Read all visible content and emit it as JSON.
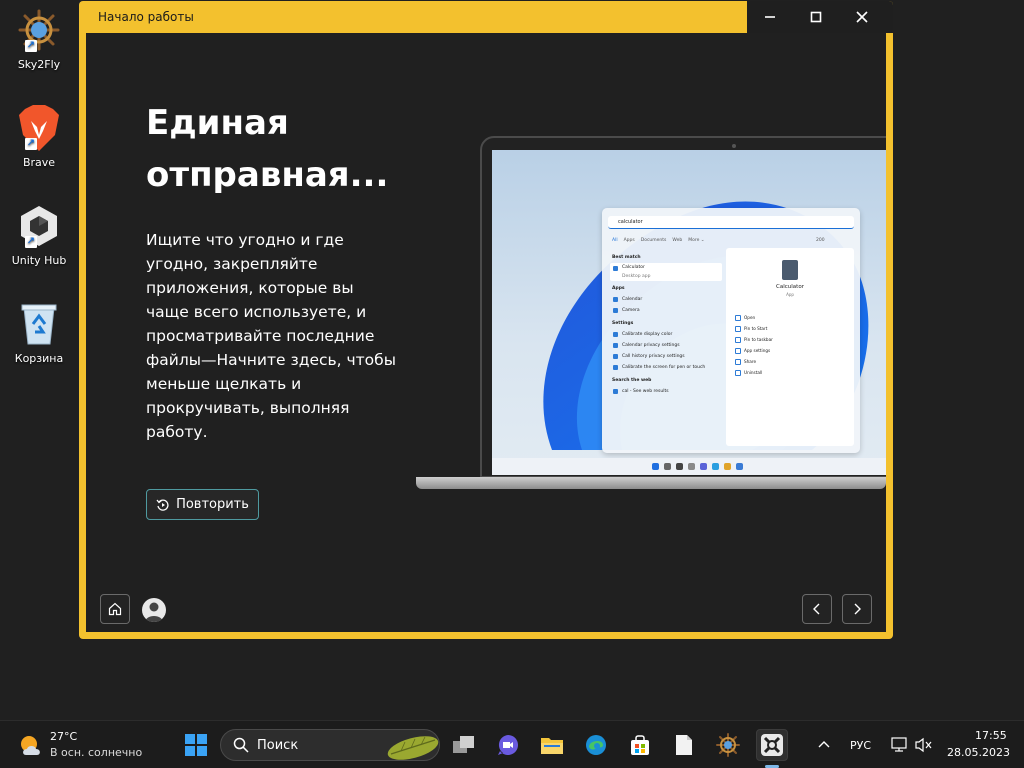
{
  "desktop": {
    "icons": [
      {
        "label": "Sky2Fly",
        "icon": "ship-wheel-icon"
      },
      {
        "label": "Brave",
        "icon": "brave-lion-icon"
      },
      {
        "label": "Unity Hub",
        "icon": "unity-cube-icon"
      },
      {
        "label": "Корзина",
        "icon": "recycle-bin-icon"
      }
    ]
  },
  "window": {
    "title": "Начало работы",
    "heading_line1": "Единая",
    "heading_line2": "отправная...",
    "description": "Ищите что угодно и где угодно, закрепляйте приложения, которые вы чаще всего используете, и просматривайте последние файлы—Начните здесь, чтобы меньше щелкать и прокручивать, выполняя работу.",
    "repeat_label": "Повторить",
    "accent": "#f3c12e"
  },
  "laptop_screen": {
    "search_query": "calculator",
    "tabs": [
      "All",
      "Apps",
      "Documents",
      "Web",
      "More ⌄"
    ],
    "count": "200",
    "best_match_title": "Best match",
    "best_match_name": "Calculator",
    "best_match_sub": "Desktop app",
    "apps_title": "Apps",
    "apps": [
      "Calendar",
      "Camera"
    ],
    "settings_title": "Settings",
    "settings": [
      "Calibrate display color",
      "Calendar privacy settings",
      "Call history privacy settings",
      "Calibrate the screen for pen or touch"
    ],
    "web_title": "Search the web",
    "web_item": "cal - See web results",
    "right_name": "Calculator",
    "right_sub": "App",
    "actions": [
      "Open",
      "Pin to Start",
      "Pin to taskbar",
      "App settings",
      "Share",
      "Uninstall"
    ]
  },
  "taskbar": {
    "temperature": "27°C",
    "weather_text": "В осн. солнечно",
    "search_label": "Поиск",
    "language": "РУС",
    "time": "17:55",
    "date": "28.05.2023"
  }
}
